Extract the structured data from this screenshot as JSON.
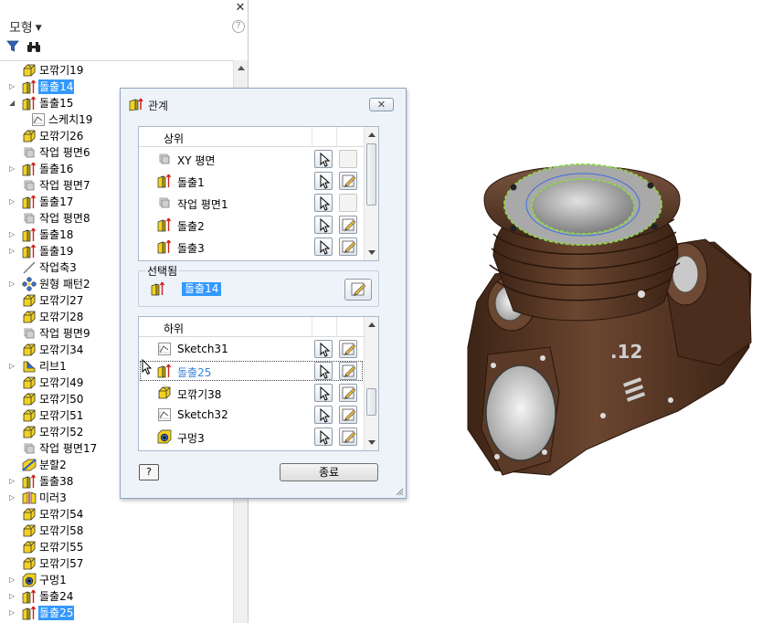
{
  "browser": {
    "title": "모형",
    "close_glyph": "✕",
    "help_glyph": "?",
    "tree": [
      {
        "label": "모깎기19",
        "icon": "fillet-icon",
        "expander": "",
        "indent": 0
      },
      {
        "label": "돌출14",
        "icon": "extrude-icon",
        "expander": "▷",
        "indent": 0,
        "selected": true
      },
      {
        "label": "돌출15",
        "icon": "extrude-icon",
        "expander": "◢",
        "indent": 0
      },
      {
        "label": "스케치19",
        "icon": "sketch-icon",
        "expander": "",
        "indent": 1
      },
      {
        "label": "모깎기26",
        "icon": "fillet-icon",
        "expander": "",
        "indent": 0
      },
      {
        "label": "작업 평면6",
        "icon": "workplane-icon",
        "expander": "",
        "indent": 0
      },
      {
        "label": "돌출16",
        "icon": "extrude-icon",
        "expander": "▷",
        "indent": 0
      },
      {
        "label": "작업 평면7",
        "icon": "workplane-icon",
        "expander": "",
        "indent": 0
      },
      {
        "label": "돌출17",
        "icon": "extrude-icon",
        "expander": "▷",
        "indent": 0
      },
      {
        "label": "작업 평면8",
        "icon": "workplane-icon",
        "expander": "",
        "indent": 0
      },
      {
        "label": "돌출18",
        "icon": "extrude-icon",
        "expander": "▷",
        "indent": 0
      },
      {
        "label": "돌출19",
        "icon": "extrude-icon",
        "expander": "▷",
        "indent": 0
      },
      {
        "label": "작업축3",
        "icon": "workaxis-icon",
        "expander": "",
        "indent": 0
      },
      {
        "label": "원형 패턴2",
        "icon": "pattern-icon",
        "expander": "▷",
        "indent": 0
      },
      {
        "label": "모깎기27",
        "icon": "fillet-icon",
        "expander": "",
        "indent": 0
      },
      {
        "label": "모깎기28",
        "icon": "fillet-icon",
        "expander": "",
        "indent": 0
      },
      {
        "label": "작업 평면9",
        "icon": "workplane-icon",
        "expander": "",
        "indent": 0
      },
      {
        "label": "모깎기34",
        "icon": "fillet-icon",
        "expander": "",
        "indent": 0
      },
      {
        "label": "리브1",
        "icon": "rib-icon",
        "expander": "▷",
        "indent": 0
      },
      {
        "label": "모깎기49",
        "icon": "fillet-icon",
        "expander": "",
        "indent": 0
      },
      {
        "label": "모깎기50",
        "icon": "fillet-icon",
        "expander": "",
        "indent": 0
      },
      {
        "label": "모깎기51",
        "icon": "fillet-icon",
        "expander": "",
        "indent": 0
      },
      {
        "label": "모깎기52",
        "icon": "fillet-icon",
        "expander": "",
        "indent": 0
      },
      {
        "label": "작업 평면17",
        "icon": "workplane-icon",
        "expander": "",
        "indent": 0
      },
      {
        "label": "분할2",
        "icon": "split-icon",
        "expander": "",
        "indent": 0
      },
      {
        "label": "돌출38",
        "icon": "extrude-icon",
        "expander": "▷",
        "indent": 0
      },
      {
        "label": "미러3",
        "icon": "mirror-icon",
        "expander": "▷",
        "indent": 0
      },
      {
        "label": "모깎기54",
        "icon": "fillet-icon",
        "expander": "",
        "indent": 0
      },
      {
        "label": "모깎기58",
        "icon": "fillet-icon",
        "expander": "",
        "indent": 0
      },
      {
        "label": "모깎기55",
        "icon": "fillet-icon",
        "expander": "",
        "indent": 0
      },
      {
        "label": "모깎기57",
        "icon": "fillet-icon",
        "expander": "",
        "indent": 0
      },
      {
        "label": "구멍1",
        "icon": "hole-icon",
        "expander": "▷",
        "indent": 0
      },
      {
        "label": "돌출24",
        "icon": "extrude-icon",
        "expander": "▷",
        "indent": 0
      },
      {
        "label": "돌출25",
        "icon": "extrude-icon",
        "expander": "▷",
        "indent": 0,
        "selected": true
      }
    ]
  },
  "dialog": {
    "title": "관계",
    "close_glyph": "✕",
    "parents": {
      "header": "상위",
      "rows": [
        {
          "label": "XY 평면",
          "icon": "workplane-icon",
          "edit_enabled": false
        },
        {
          "label": "돌출1",
          "icon": "extrude-icon",
          "edit_enabled": true
        },
        {
          "label": "작업 평면1",
          "icon": "workplane-icon",
          "edit_enabled": false
        },
        {
          "label": "돌출2",
          "icon": "extrude-icon",
          "edit_enabled": true
        },
        {
          "label": "돌출3",
          "icon": "extrude-icon",
          "edit_enabled": true
        }
      ]
    },
    "selected": {
      "label": "선택됨",
      "name": "돌출14"
    },
    "children": {
      "header": "하위",
      "rows": [
        {
          "label": "Sketch31",
          "icon": "sketch-icon",
          "edit_enabled": true
        },
        {
          "label": "돌출25",
          "icon": "extrude-icon",
          "edit_enabled": true,
          "highlight": true
        },
        {
          "label": "모깎기38",
          "icon": "fillet-icon",
          "edit_enabled": true
        },
        {
          "label": "Sketch32",
          "icon": "sketch-icon",
          "edit_enabled": true
        },
        {
          "label": "구멍3",
          "icon": "hole-icon",
          "edit_enabled": true
        }
      ]
    },
    "help_label": "?",
    "close_label": "종료"
  },
  "model": {
    "engraving": ".12",
    "body_color": "#5a3a26",
    "bore_color": "#b9b9b9",
    "edge_highlight": "#8fd14f"
  }
}
